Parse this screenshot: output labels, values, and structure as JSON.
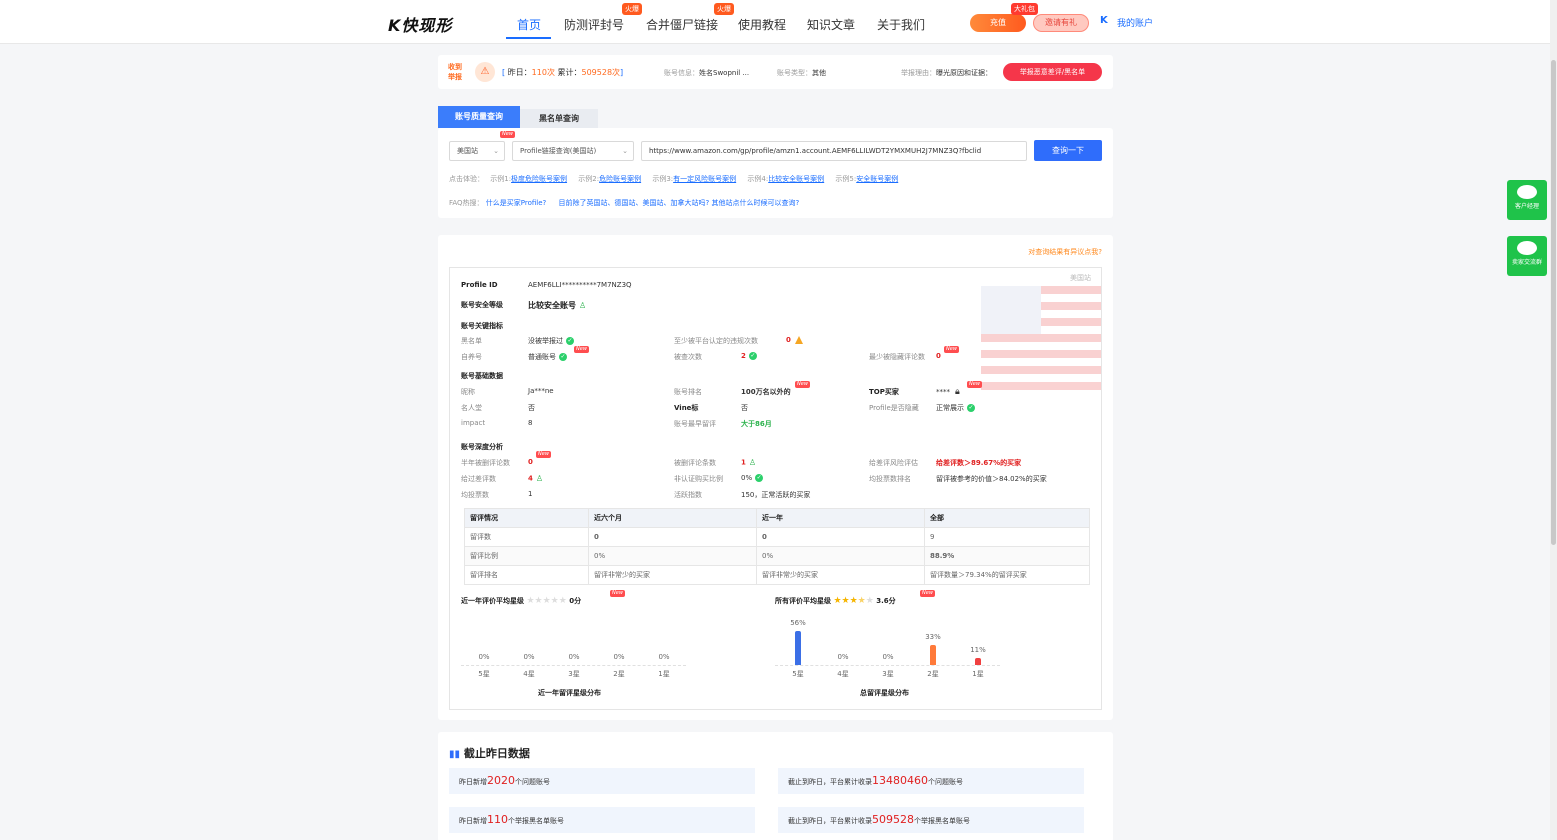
{
  "brand": {
    "logo": "K快现形"
  },
  "nav": {
    "items": [
      "首页",
      "防测评封号",
      "合并僵尸链接",
      "使用教程",
      "知识文章",
      "关于我们"
    ],
    "hot_label": "火爆",
    "recharge": "充值",
    "invite": "邀请有礼",
    "gift": "大礼包",
    "account": "我的账户"
  },
  "alert": {
    "label": "收到举报",
    "yesterday_prefix": "昨日：",
    "yesterday": "110次",
    "total_prefix": "累计：",
    "total": "509528次",
    "acct_info_label": "账号信息：",
    "acct_info": "姓名Swopnil ...",
    "acct_type_label": "账号类型：",
    "acct_type": "其他",
    "reason_label": "举报理由：",
    "reason": "曝光原因和证据：",
    "report_btn": "举报恶意差评/黑名单"
  },
  "tabs": {
    "quality": "账号质量查询",
    "blacklist": "黑名单查询"
  },
  "search": {
    "site": "美国站",
    "mode": "Profile链接查询(美国站)",
    "url": "https://www.amazon.com/gp/profile/amzn1.account.AEMF6LLILWDT2YMXMUH2J7MNZ3Q?fbclid",
    "query_btn": "查询一下",
    "examples_label": "点击体验：",
    "examples": [
      {
        "prefix": "示例1:",
        "text": "极度危险账号案例"
      },
      {
        "prefix": "示例2:",
        "text": "危险账号案例"
      },
      {
        "prefix": "示例3:",
        "text": "有一定风险账号案例"
      },
      {
        "prefix": "示例4:",
        "text": "比较安全账号案例"
      },
      {
        "prefix": "示例5:",
        "text": "安全账号案例"
      }
    ],
    "faq_label": "FAQ热搜：",
    "faqs": [
      "什么是买家Profile?",
      "目前除了英国站、德国站、美国站、加拿大站吗? 其他站点什么时候可以查询?"
    ]
  },
  "report": {
    "dispute": "对查询结果有异议点我?",
    "site_tag": "美国站",
    "profile_id_label": "Profile ID",
    "profile_id": "AEMF6LLI**********7M7NZ3Q",
    "level_label": "账号安全等级",
    "level": "比较安全账号",
    "sec_key": "账号关键指标",
    "blacklist_label": "黑名单",
    "blacklist_val": "没被举报过",
    "violations_label": "至少被平台认定的违规次数",
    "violations_val": "0",
    "self_label": "自养号",
    "self_val": "普通账号",
    "checks_label": "被查次数",
    "checks_val": "2",
    "hidden_label": "最少被隐藏评论数",
    "hidden_val": "0",
    "sec_basic": "账号基础数据",
    "nick_label": "昵称",
    "nick": "Ja***ne",
    "rank_label": "账号排名",
    "rank": "100万名以外的",
    "top_label": "TOP买家",
    "top": "****",
    "fame_label": "名人堂",
    "fame": "否",
    "vine_label": "Vine标",
    "vine": "否",
    "hidden_profile_label": "Profile是否隐藏",
    "hidden_profile": "正常展示",
    "impact_label": "impact",
    "impact": "8",
    "early_label": "账号最早留评",
    "early": "大于86月",
    "sec_deep": "账号深度分析",
    "half_del_label": "半年被删评论数",
    "half_del": "0",
    "deleted_label": "被删评论条数",
    "deleted": "1",
    "risk_label": "给差评风险评估",
    "risk": "给差评数＞89.67%的买家",
    "neg_label": "给过差评数",
    "neg": "4",
    "unverified_label": "非认证购买比例",
    "unverified": "0%",
    "vote_rank_label": "均投票数排名",
    "vote_rank": "留评被参考的价值＞84.02%的买家",
    "avg_vote_label": "均投票数",
    "avg_vote": "1",
    "active_label": "活跃指数",
    "active": "150，正常活跃的买家",
    "table": {
      "headers": [
        "留评情况",
        "近六个月",
        "近一年",
        "全部"
      ],
      "rows": [
        [
          "留评数",
          "0",
          "0",
          "9"
        ],
        [
          "留评比例",
          "0%",
          "0%",
          "88.9%"
        ],
        [
          "留评排名",
          "留评非常少的买家",
          "留评非常少的买家",
          "留评数量＞79.34%的留评买家"
        ]
      ]
    },
    "year_avg_label": "近一年评价平均星级",
    "year_avg": "0分",
    "all_avg_label": "所有评价平均星级",
    "all_avg": "3.6分"
  },
  "chart_data": [
    {
      "type": "bar",
      "title": "近一年留评星级分布",
      "categories": [
        "5星",
        "4星",
        "3星",
        "2星",
        "1星"
      ],
      "values": [
        0,
        0,
        0,
        0,
        0
      ],
      "value_labels": [
        "0%",
        "0%",
        "0%",
        "0%",
        "0%"
      ]
    },
    {
      "type": "bar",
      "title": "总留评星级分布",
      "categories": [
        "5星",
        "4星",
        "3星",
        "2星",
        "1星"
      ],
      "values": [
        56,
        0,
        0,
        33,
        11
      ],
      "value_labels": [
        "56%",
        "0%",
        "0%",
        "33%",
        "11%"
      ],
      "colors": [
        "#3b6fe6",
        "#3b6fe6",
        "#3b6fe6",
        "#ff7a3a",
        "#f04040"
      ]
    }
  ],
  "side": {
    "service": "客户经理",
    "group": "卖家交流群"
  },
  "stats": {
    "title": "截止昨日数据",
    "b1_pre": "昨日新增",
    "b1_num": "2020",
    "b1_post": "个问题账号",
    "b2_pre": "截止到昨日，平台累计收录",
    "b2_num": "13480460",
    "b2_post": "个问题账号",
    "b3_pre": "昨日新增",
    "b3_num": "110",
    "b3_post": "个举报黑名单账号",
    "b4_pre": "截止到昨日，平台累计收录",
    "b4_num": "509528",
    "b4_post": "个举报黑名单账号"
  }
}
